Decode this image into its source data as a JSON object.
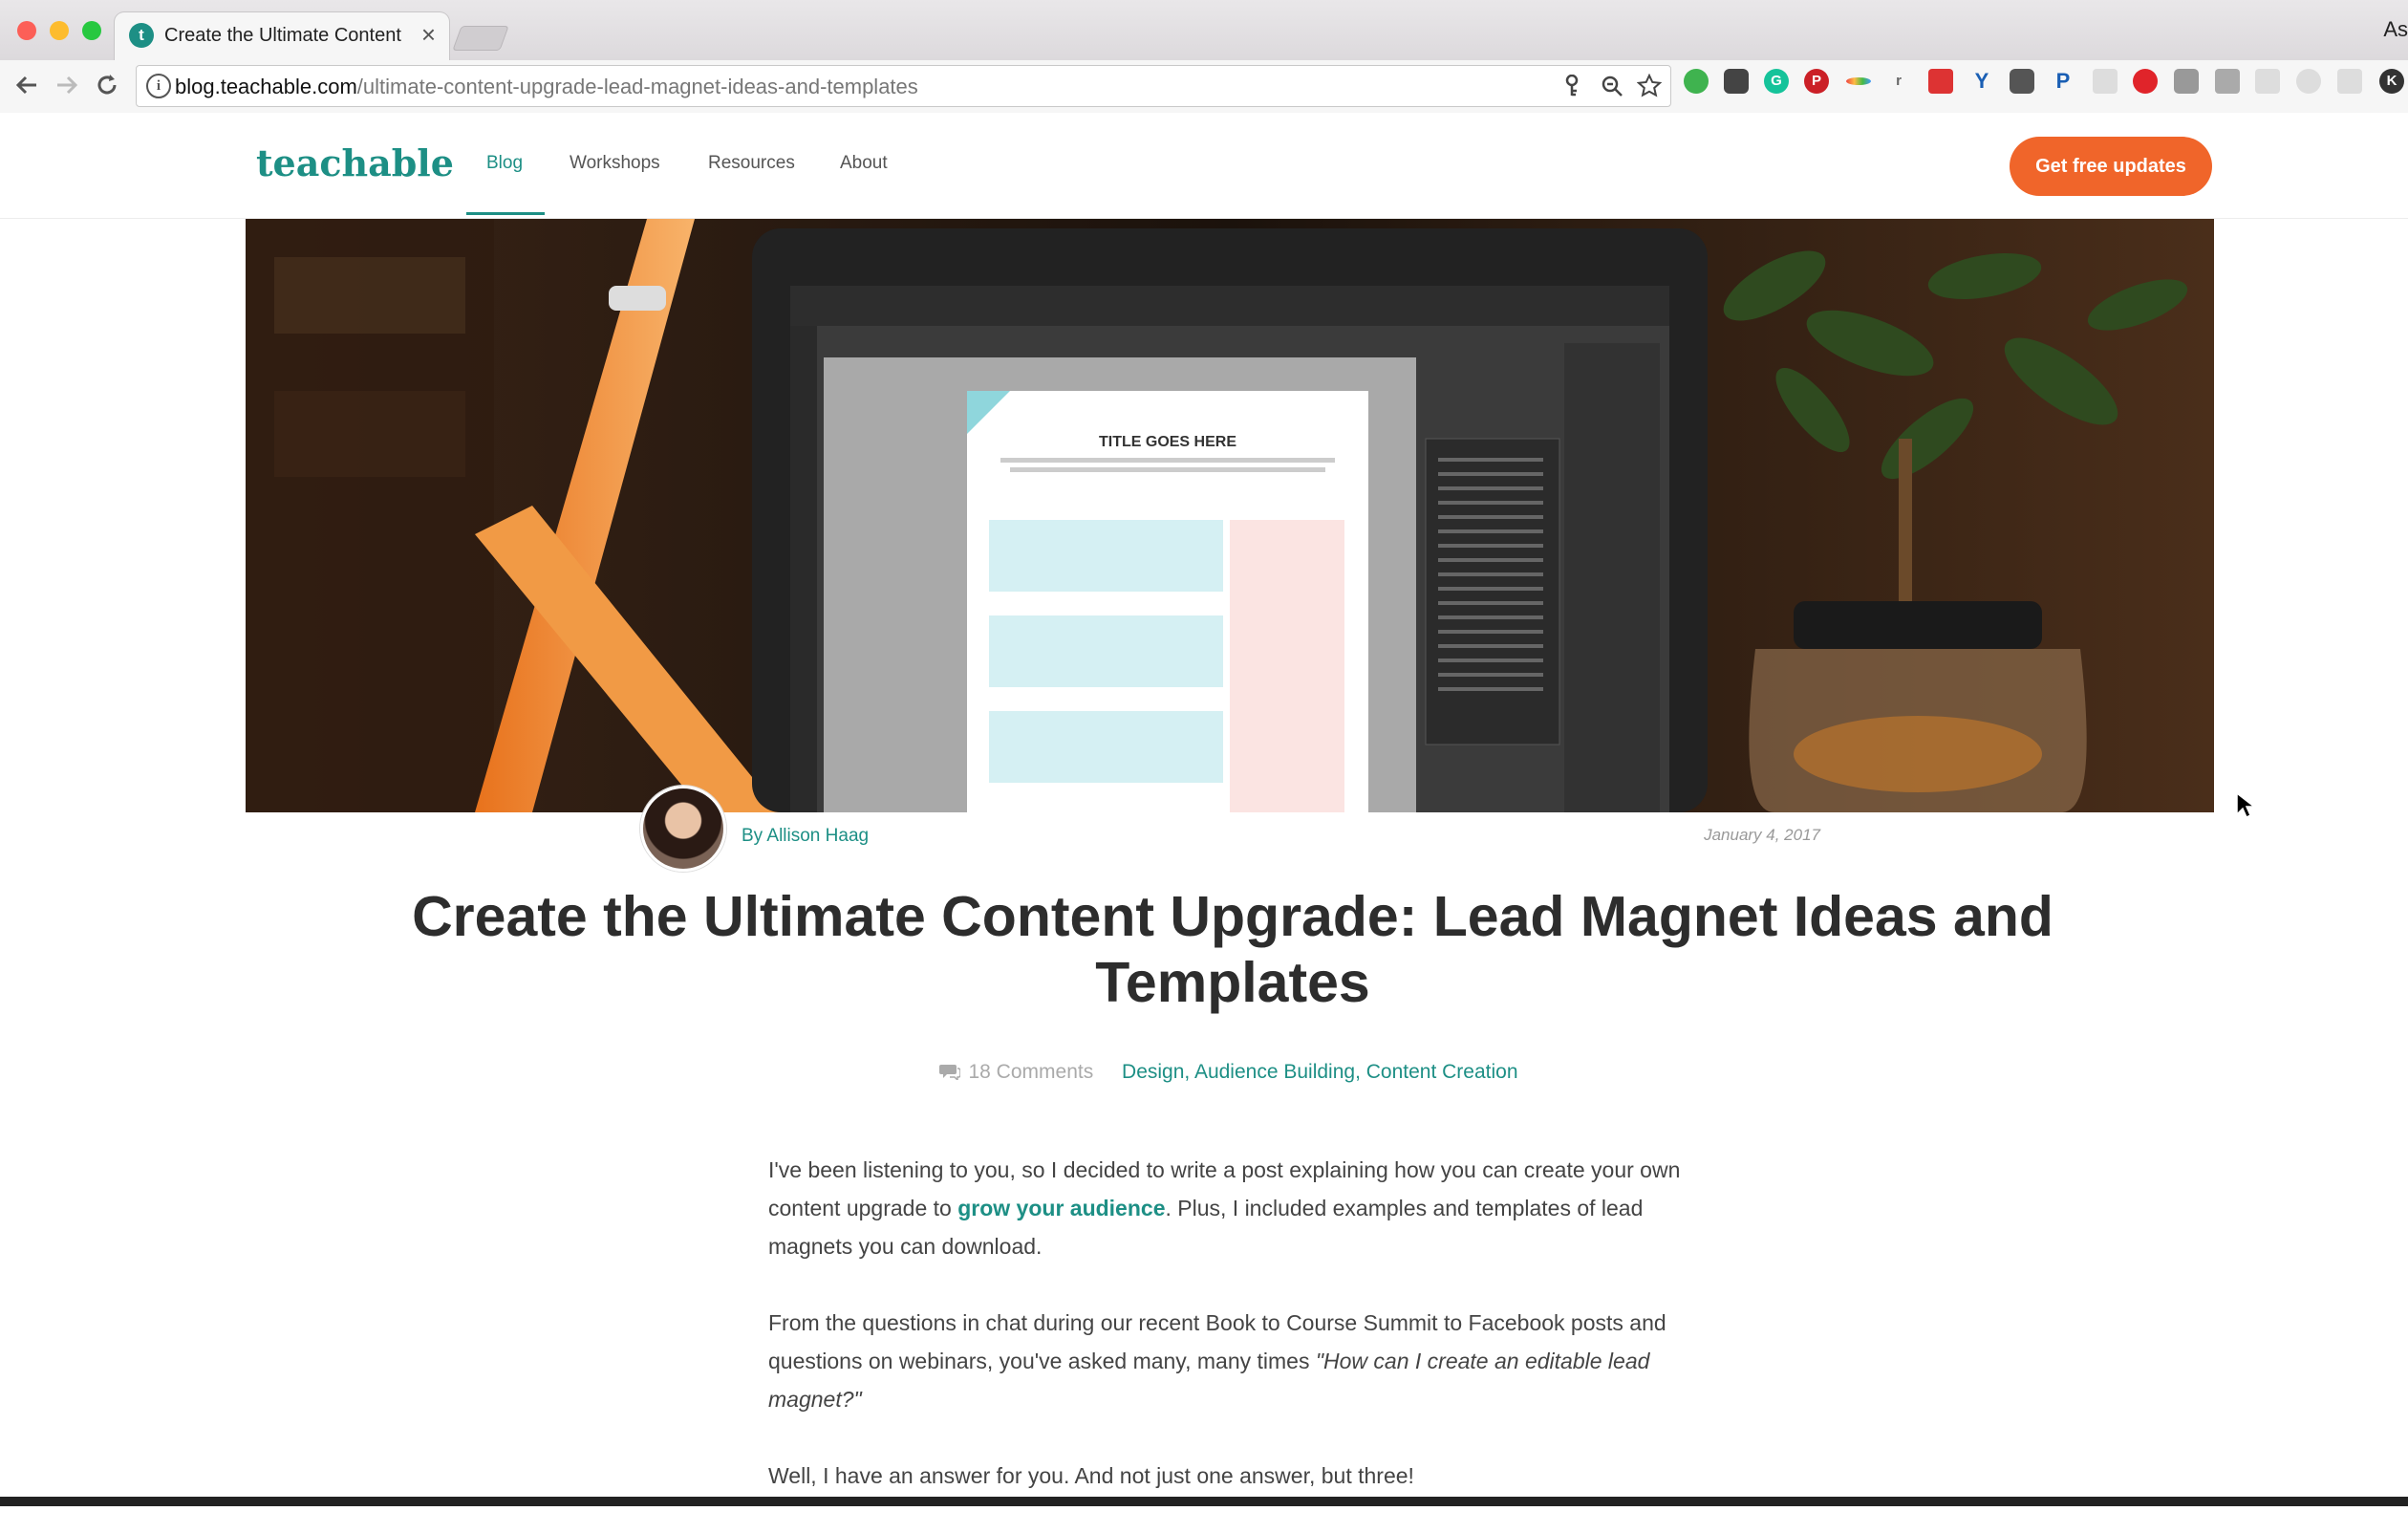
{
  "browser": {
    "tab_title": "Create the Ultimate Content U",
    "tab_close": "×",
    "tab_favicon_letter": "t",
    "corner_text": "As",
    "url_host": "blog.teachable.com",
    "url_path": "/ultimate-content-upgrade-lead-magnet-ideas-and-templates",
    "info_glyph": "i"
  },
  "header": {
    "logo": "teachable",
    "nav": [
      "Blog",
      "Workshops",
      "Resources",
      "About"
    ],
    "active_nav": "Blog",
    "cta_label": "Get free updates"
  },
  "hero": {
    "screen_title": "TITLE GOES HERE"
  },
  "post": {
    "author": "By Allison Haag",
    "date": "January 4, 2017",
    "title": "Create the Ultimate Content Upgrade: Lead Magnet Ideas and Templates",
    "comments": "18 Comments",
    "categories": [
      "Design",
      "Audience Building",
      "Content Creation"
    ],
    "p1_before": "I've been listening to you, so I decided to write a post explaining how you can create your own content upgrade to ",
    "p1_link": "grow your audience",
    "p1_after": ". Plus, I included examples and templates of lead magnets you can download.",
    "p2_before": "From the questions in chat during our recent Book to Course Summit to Facebook posts and questions on webinars, you've asked many, many times ",
    "p2_quote": "\"How can I create an editable lead magnet?\"",
    "p3": "Well, I have an answer for you. And not just one answer, but three!"
  },
  "colors": {
    "brand": "#1d8f85",
    "cta": "#f0652a"
  },
  "icons": {
    "back": "arrow-left-icon",
    "forward": "arrow-right-icon",
    "reload": "reload-icon",
    "key": "key-icon",
    "zoom": "zoom-icon",
    "star": "star-icon",
    "comment": "comment-icon"
  }
}
